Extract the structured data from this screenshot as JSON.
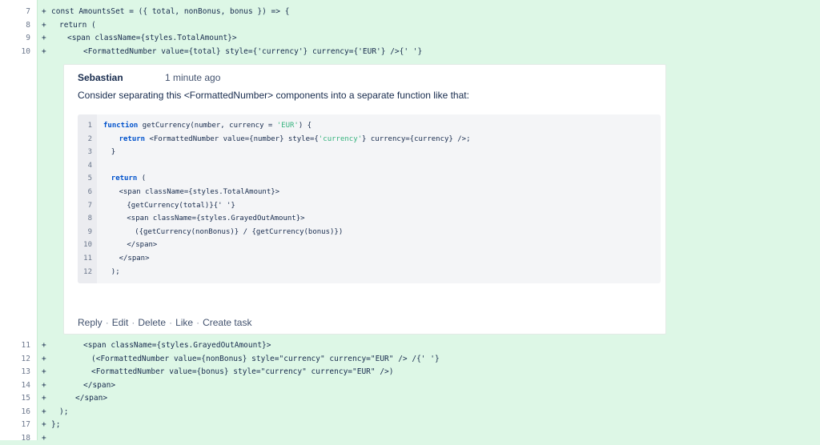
{
  "diff_top": [
    {
      "num": "7",
      "indent": 0,
      "text": "const AmountsSet = ({ total, nonBonus, bonus }) => {"
    },
    {
      "num": "8",
      "indent": 1,
      "text": "return ("
    },
    {
      "num": "9",
      "indent": 2,
      "text": "<span className={styles.TotalAmount}>"
    },
    {
      "num": "10",
      "indent": 4,
      "text": "<FormattedNumber value={total} style={'currency'} currency={'EUR'} />{' '}"
    }
  ],
  "diff_bottom": [
    {
      "num": "11",
      "indent": 4,
      "text": "<span className={styles.GrayedOutAmount}>"
    },
    {
      "num": "12",
      "indent": 5,
      "text": "(<FormattedNumber value={nonBonus} style=\"currency\" currency=\"EUR\" /> /{' '}"
    },
    {
      "num": "13",
      "indent": 5,
      "text": "<FormattedNumber value={bonus} style=\"currency\" currency=\"EUR\" />)"
    },
    {
      "num": "14",
      "indent": 4,
      "text": "</span>"
    },
    {
      "num": "15",
      "indent": 3,
      "text": "</span>"
    },
    {
      "num": "16",
      "indent": 1,
      "text": ");"
    },
    {
      "num": "17",
      "indent": 0,
      "text": "};"
    },
    {
      "num": "18",
      "indent": 0,
      "text": ""
    }
  ],
  "plus_sign": "+",
  "comment": {
    "author": "Sebastian",
    "time": "1 minute ago",
    "message": "Consider separating this <FormattedNumber> components into a separate function like that:",
    "snippet": [
      {
        "n": "1",
        "indent": 0,
        "parts": [
          {
            "k": "kw",
            "t": "function"
          },
          {
            "k": "",
            "t": " getCurrency(number, currency = "
          },
          {
            "k": "str",
            "t": "'EUR'"
          },
          {
            "k": "",
            "t": ") {"
          }
        ]
      },
      {
        "n": "2",
        "indent": 2,
        "parts": [
          {
            "k": "kw",
            "t": "return"
          },
          {
            "k": "",
            "t": " <FormattedNumber value={number} style={"
          },
          {
            "k": "str",
            "t": "'currency'"
          },
          {
            "k": "",
            "t": "} currency={currency} />;"
          }
        ]
      },
      {
        "n": "3",
        "indent": 1,
        "parts": [
          {
            "k": "",
            "t": "}"
          }
        ]
      },
      {
        "n": "4",
        "indent": 0,
        "parts": []
      },
      {
        "n": "5",
        "indent": 1,
        "parts": [
          {
            "k": "kw",
            "t": "return"
          },
          {
            "k": "",
            "t": " ("
          }
        ]
      },
      {
        "n": "6",
        "indent": 2,
        "parts": [
          {
            "k": "",
            "t": "<span className={styles.TotalAmount}>"
          }
        ]
      },
      {
        "n": "7",
        "indent": 3,
        "parts": [
          {
            "k": "",
            "t": "{getCurrency(total)}{' '}"
          }
        ]
      },
      {
        "n": "8",
        "indent": 3,
        "parts": [
          {
            "k": "",
            "t": "<span className={styles.GrayedOutAmount}>"
          }
        ]
      },
      {
        "n": "9",
        "indent": 4,
        "parts": [
          {
            "k": "",
            "t": "({getCurrency(nonBonus)} / {getCurrency(bonus)})"
          }
        ]
      },
      {
        "n": "10",
        "indent": 3,
        "parts": [
          {
            "k": "",
            "t": "</span>"
          }
        ]
      },
      {
        "n": "11",
        "indent": 2,
        "parts": [
          {
            "k": "",
            "t": "</span>"
          }
        ]
      },
      {
        "n": "12",
        "indent": 1,
        "parts": [
          {
            "k": "",
            "t": ");"
          }
        ]
      }
    ],
    "actions": [
      "Reply",
      "Edit",
      "Delete",
      "Like",
      "Create task"
    ]
  },
  "colors": {
    "added_bg": "#ddf7e6",
    "keyword": "#0052cc",
    "string": "#36b37e"
  }
}
